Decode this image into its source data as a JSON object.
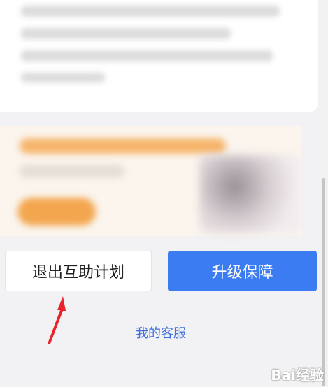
{
  "buttons": {
    "exit_label": "退出互助计划",
    "upgrade_label": "升级保障"
  },
  "links": {
    "customer_service": "我的客服"
  },
  "watermark": "Bai经验",
  "colors": {
    "accent": "#3c7cf2",
    "link": "#3d6fe0",
    "background": "#f2f2f4",
    "arrow": "#e8232c"
  },
  "icons": {
    "annotation_arrow": "red-arrow-icon"
  }
}
